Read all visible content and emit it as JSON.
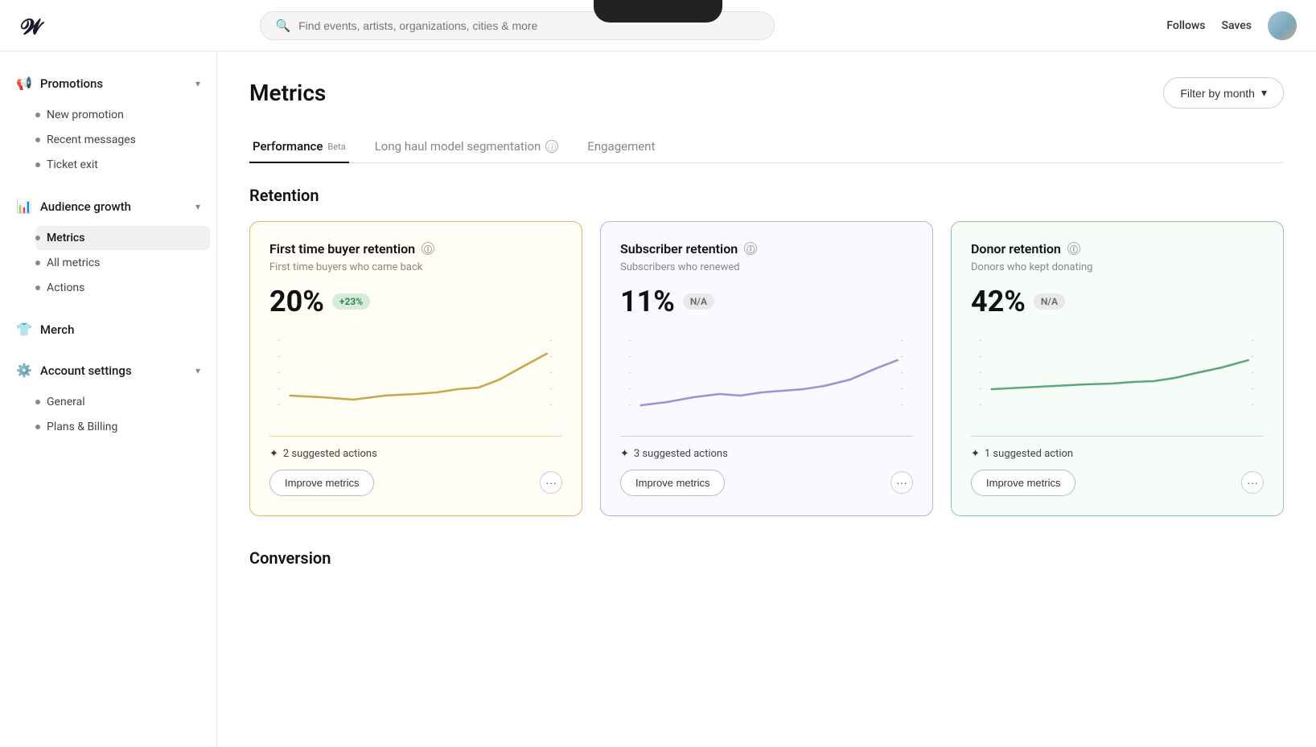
{
  "app": {
    "logo_symbol": "𝕎",
    "notch": true
  },
  "header": {
    "search_placeholder": "Find events, artists, organizations, cities & more",
    "follows_label": "Follows",
    "saves_label": "Saves"
  },
  "sidebar": {
    "promotions_label": "Promotions",
    "promotions_items": [
      {
        "label": "New promotion",
        "active": false
      },
      {
        "label": "Recent messages",
        "active": false
      },
      {
        "label": "Ticket exit",
        "active": false
      }
    ],
    "audience_growth_label": "Audience growth",
    "audience_items": [
      {
        "label": "Metrics",
        "active": true
      },
      {
        "label": "All metrics",
        "active": false
      },
      {
        "label": "Actions",
        "active": false
      }
    ],
    "merch_label": "Merch",
    "account_settings_label": "Account settings",
    "account_items": [
      {
        "label": "General",
        "active": false
      },
      {
        "label": "Plans & Billing",
        "active": false
      }
    ]
  },
  "page": {
    "title": "Metrics",
    "filter_label": "Filter by month",
    "tabs": [
      {
        "label": "Performance",
        "badge": "Beta",
        "active": true,
        "has_info": false
      },
      {
        "label": "Long haul model segmentation",
        "badge": null,
        "active": false,
        "has_info": true
      },
      {
        "label": "Engagement",
        "badge": null,
        "active": false,
        "has_info": false
      }
    ],
    "retention_title": "Retention",
    "cards": [
      {
        "id": "first-time-buyer",
        "title": "First time buyer retention",
        "subtitle": "First time buyers who came back",
        "metric": "20%",
        "badge": "+23%",
        "badge_type": "green",
        "suggested_count": "2 suggested actions",
        "improve_label": "Improve metrics",
        "border": "yellow"
      },
      {
        "id": "subscriber",
        "title": "Subscriber retention",
        "subtitle": "Subscribers who renewed",
        "metric": "11%",
        "badge": "N/A",
        "badge_type": "gray",
        "suggested_count": "3 suggested actions",
        "improve_label": "Improve metrics",
        "border": "purple"
      },
      {
        "id": "donor",
        "title": "Donor retention",
        "subtitle": "Donors who kept donating",
        "metric": "42%",
        "badge": "N/A",
        "badge_type": "gray",
        "suggested_count": "1 suggested action",
        "improve_label": "Improve metrics",
        "border": "green"
      }
    ],
    "conversion_title": "Conversion"
  }
}
